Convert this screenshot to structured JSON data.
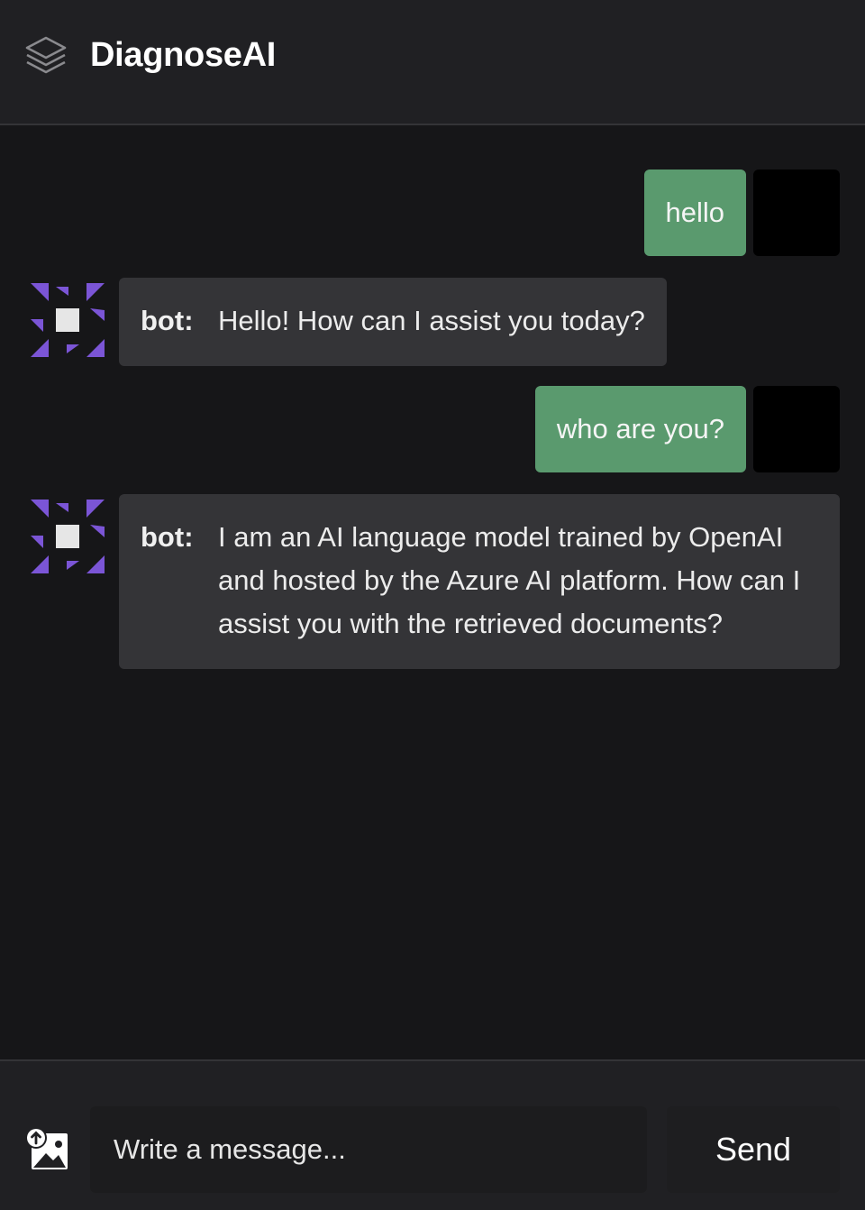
{
  "header": {
    "title": "DiagnoseAI",
    "logo_icon": "layers-icon"
  },
  "messages": [
    {
      "role": "user",
      "text": "hello"
    },
    {
      "role": "bot",
      "label": "bot:",
      "text": "Hello! How can I assist you today?"
    },
    {
      "role": "user",
      "text": "who are you?"
    },
    {
      "role": "bot",
      "label": "bot:",
      "text": "I am an AI language model trained by OpenAI and hosted by the Azure AI platform. How can I assist you with the retrieved documents?"
    }
  ],
  "composer": {
    "placeholder": "Write a message...",
    "send_label": "Send",
    "upload_icon": "image-upload-icon"
  },
  "colors": {
    "user_bubble": "#5a9a6e",
    "bot_bubble": "#343437",
    "bot_avatar_accent": "#7b55d6"
  }
}
